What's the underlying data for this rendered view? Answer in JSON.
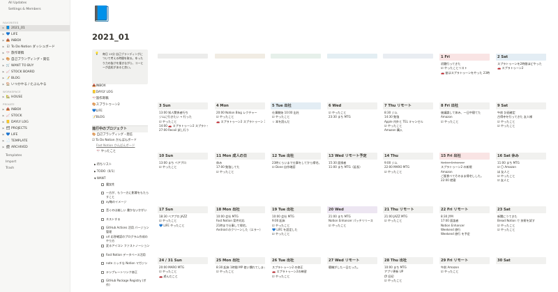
{
  "sidebar": {
    "top": [
      "All Updates",
      "Settings & Members"
    ],
    "favorites_label": "FAVORITES",
    "favorites": [
      {
        "icon": "📘",
        "label": "2021_01",
        "selected": true
      },
      {
        "icon": "💙",
        "label": "LIFE"
      },
      {
        "icon": "📥",
        "label": "INBOX"
      },
      {
        "icon": "☑",
        "label": "To Do Notion ダッシュボード"
      },
      {
        "icon": "🎌",
        "label": "旅作寄稿"
      },
      {
        "icon": "🎨",
        "label": "自己ブランディング・発信"
      },
      {
        "icon": "🛒",
        "label": "WANT TO BUY"
      },
      {
        "icon": "📈",
        "label": "STOCK BOARD"
      },
      {
        "icon": "📝",
        "label": "BLOG"
      },
      {
        "icon": "🏠",
        "label": "いつかやる / たぶんやる"
      }
    ],
    "workspace_label": "WORKSPACE",
    "workspace": [
      {
        "icon": "🏡",
        "label": "HOUSE"
      }
    ],
    "private_label": "PRIVATE",
    "private": [
      {
        "icon": "📥",
        "label": "INBOX"
      },
      {
        "icon": "📈",
        "label": "STOCK"
      },
      {
        "icon": "📒",
        "label": "DAYLY LOG"
      },
      {
        "icon": "🗂",
        "label": "PROJECTS"
      },
      {
        "icon": "💙",
        "label": "LIFE"
      },
      {
        "icon": "📄",
        "label": "TEMPLATE"
      },
      {
        "icon": "🗃",
        "label": "ARCHIVED"
      }
    ],
    "bottom": [
      "Templates",
      "Import",
      "Trash"
    ]
  },
  "page": {
    "icon": "📘",
    "title": "2021_01",
    "callout_icon": "💡",
    "callout_text": "毎日 15分 自己ブランディングについて考える時間を取る。ゆったり力の抜けを描きながら、コーヒーが此処があると良い。",
    "links": [
      {
        "icon": "📥",
        "label": "INBOX"
      },
      {
        "icon": "📒",
        "label": "DAYLY LOG"
      },
      {
        "icon": "🎌",
        "label": "旅作寄稿"
      },
      {
        "icon": "🎨",
        "label": "スプラトゥーン2"
      },
      {
        "icon": "💙",
        "label": "LIFE"
      },
      {
        "icon": "📝",
        "label": "BLOG"
      }
    ],
    "project_header": "進行中のプロジェクト",
    "projects": [
      "🎨 自己ブランディング・発信",
      "☑ To Do Notion かんばんボード",
      "Fast Notion かんばんボード",
      "🎌 やったこと"
    ],
    "toggles": [
      "待ちリスト",
      "TODO（0/1）",
      "WANT"
    ],
    "want_list": [
      "魔女性",
      "一方が、もう一方に影響をもたらすこと",
      "xy軸のイメージ",
      "音くのは楽しい 書かないかがい",
      "ネストする",
      "GitHub Actions 活用 バージョン管理",
      "url 応答確認のプログラム作成のやり方",
      "変るアイコン ファストノーション",
      "Fast Notion データベース活用",
      "note ニッチな Notion マガジン",
      "テンプレートリンク修正",
      "GitHub Package Registry (ボ作)"
    ]
  },
  "calendar": {
    "days": [
      {
        "label": "1 Fri",
        "color": "red",
        "events": [
          "初雛行ってきた",
          "☑ やったことリスト",
          "🚗 彼はスプラトゥーンをやった 23時くらいまで 全試した"
        ]
      },
      {
        "label": "2 Sat",
        "color": "blue",
        "events": [
          "スプラトゥーンを2時間ほどやった",
          "🚗 スプラトゥーン2"
        ]
      },
      {
        "label": "3 Sun",
        "color": "",
        "events": [
          "13:00 知人関係者行ち",
          "ジムに行きたい → 行った",
          "☑ やったこと",
          "14:00 🚗 スプラトゥーン2 スプラトゥーン 3時間",
          "27:00 Recoil 試し行う"
        ]
      },
      {
        "label": "4 Mon",
        "color": "",
        "events": [
          "20:00 Notion Blog レクチャー",
          "☑ やったこと",
          "🚗 スプラトゥーン2 スプラトゥーン 30分"
        ]
      },
      {
        "label": "5 Tue 出社",
        "color": "blue",
        "events": [
          "仕事開始 10:00 出社",
          "☑ やったこと",
          "☆ 本を読んだ"
        ]
      },
      {
        "label": "6 Wed",
        "color": "",
        "events": [
          "☑ やったこと",
          "23:30 まち MTG"
        ]
      },
      {
        "label": "7 Thu リモート",
        "color": "",
        "events": [
          "8:30 ジム",
          "14:30 勉強",
          "Apple 内外と TEL キャンセル",
          "☑ やったこと",
          "Amazon 購入"
        ]
      },
      {
        "label": "8 Fri 出社",
        "color": "",
        "events": [
          "後議論して休み、一日中寝てた",
          "Amazon",
          "☑ やったこと"
        ]
      },
      {
        "label": "9 Sat",
        "color": "",
        "events": [
          "午前 計画確定",
          "古得寺を行ってきた 友人様",
          "☑ やったこと",
          "☑ やったこと"
        ]
      },
      {
        "label": "10 Sun",
        "color": "",
        "events": [
          "13:00 まち ベアプロ",
          "☑ やったこと"
        ]
      },
      {
        "label": "11 Mon 成人の日",
        "color": "",
        "events": [
          "休み",
          "17:00 勉強してた",
          "☑ やったこと"
        ]
      },
      {
        "label": "12 Tue 出社",
        "color": "",
        "events": [
          "23時くらいまで仕事をしてから帰宅。新しい、ネイティブ 試み",
          "☑ Done 自作確認"
        ]
      },
      {
        "label": "13 Wed リモート予定",
        "color": "",
        "events": [
          "15:30 面接者",
          "11:00 まち MTG（延長）"
        ]
      },
      {
        "label": "14 Thu",
        "color": "",
        "events": [
          "9:00 ジム",
          "22:00 MARO MTG",
          "☑ やったこと"
        ]
      },
      {
        "label": "15 Fri 出社",
        "color": "red",
        "events": [
          "Notion Enhancer",
          "スプラトゥーン2 の新規",
          "Amazon",
          "ご飯食べてそのまま帰宅しした。",
          "22:00 就寝"
        ]
      },
      {
        "label": "16 Sat 休み",
        "color": "",
        "events": [
          "11:00 まち MTG",
          "☑ 〇 Amazon",
          "ほ 友人と",
          "☑ やったこと",
          "☑ 友人と"
        ]
      },
      {
        "label": "17 Sun",
        "color": "",
        "events": [
          "18:30 ベアプロ JAZZ",
          "☑ やったこと",
          "💙 LIFE やったこと"
        ]
      },
      {
        "label": "18 Mon 出社",
        "color": "",
        "events": [
          "10:00 会社 MTG",
          "Fast Notion 案件対応",
          "21時まで仕事して帰宅。",
          "Android のクリーンした（エラー）"
        ]
      },
      {
        "label": "19 Tue 出社",
        "color": "",
        "events": [
          "10:00 会社 MTG",
          "9:00 起床",
          "☑ やったこと",
          "💙 LIFE を設定した",
          "☑ やったこと"
        ]
      },
      {
        "label": "20 Wed",
        "color": "purple",
        "events": [
          "21:00 まち MTG",
          "Notion Enhancer パッチリリース",
          "☑ やったこと"
        ]
      },
      {
        "label": "21 Thu リモート",
        "color": "",
        "events": [
          "21:00 JAZZ MTG",
          "☑ やったこと"
        ]
      },
      {
        "label": "22 Fri リモート",
        "color": "",
        "events": [
          "8:30 JYM",
          "17:00 面談者",
          "Notion Enhancer",
          "Weekend 旅行",
          "Weekend 旅行 を予定"
        ]
      },
      {
        "label": "23 Sat",
        "color": "",
        "events": [
          "新聞にうてきた",
          "Bread Notion で 技術を試す",
          "☑ やったこと",
          "☑ やったこと"
        ]
      },
      {
        "label": "24 / 31 Sun",
        "color": "",
        "events": [
          "20:00 MARO MTG",
          "☑ やったこと",
          "🚗 遊んだこと"
        ]
      },
      {
        "label": "25 Mon 出社",
        "color": "",
        "events": [
          "8:30 起床 1時間 MP 使い慣れてしまったような気持ちだった（ボーっとした過ぎた）",
          "☑ やったこと"
        ]
      },
      {
        "label": "26 Tue 出社",
        "color": "",
        "events": [
          "スプラトゥーン2 の修正",
          "🚗 スプラトゥーン2の練習",
          "☑ やったこと"
        ]
      },
      {
        "label": "27 Wed リモート",
        "color": "",
        "events": [
          "聴機がした一日だった。"
        ]
      },
      {
        "label": "28 Thu 出社",
        "color": "",
        "events": [
          "10:00 まち MTG",
          "アプリ更新 UP",
          "伊 旧初",
          "☑ やったこと"
        ]
      },
      {
        "label": "29 Fri リモート",
        "color": "",
        "events": [
          "午前 Amazon",
          "☑ やったこと"
        ]
      },
      {
        "label": "30 Sat",
        "color": "",
        "events": []
      }
    ]
  }
}
